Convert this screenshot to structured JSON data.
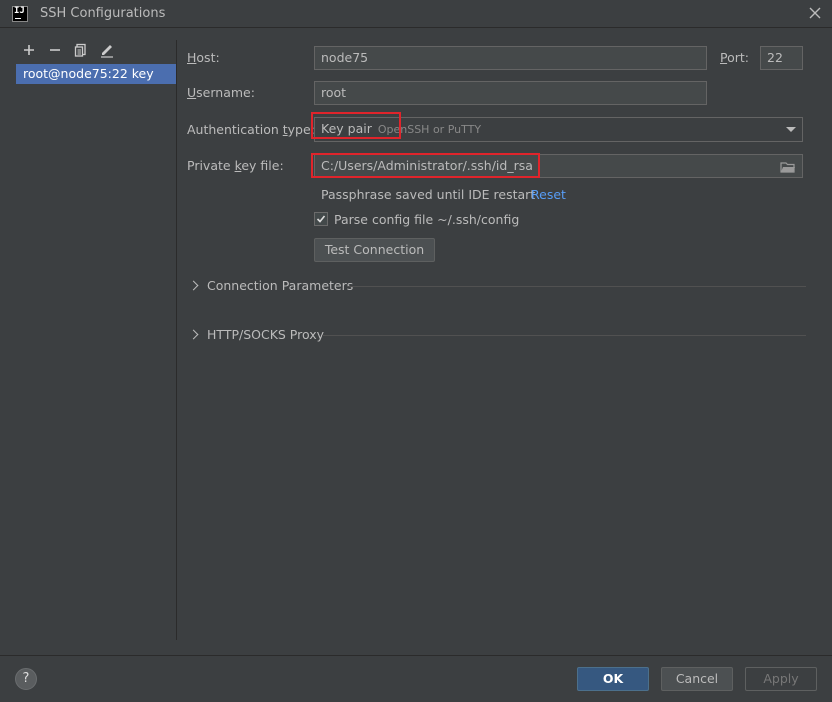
{
  "window": {
    "title": "SSH Configurations",
    "logo_text": "IJ"
  },
  "sidebar": {
    "toolbar_icons": [
      "plus-icon",
      "minus-icon",
      "copy-icon",
      "edit-icon"
    ],
    "items": [
      {
        "label": "root@node75:22 key",
        "selected": true
      }
    ]
  },
  "form": {
    "host": {
      "label_mnemonic": "H",
      "label_rest": "ost:",
      "value": "node75"
    },
    "port": {
      "label_mnemonic": "P",
      "label_rest": "ort:",
      "value": "22"
    },
    "username": {
      "label_mnemonic": "U",
      "label_rest": "sername:",
      "value": "root"
    },
    "auth": {
      "label_prefix": "Authentication ",
      "label_mnemonic": "t",
      "label_rest": "ype:",
      "value": "Key pair",
      "hint": "OpenSSH or PuTTY"
    },
    "private_key": {
      "label_prefix": "Private ",
      "label_mnemonic": "k",
      "label_rest": "ey file:",
      "value": "C:/Users/Administrator/.ssh/id_rsa"
    },
    "passphrase_text": "Passphrase saved until IDE restart",
    "reset_label": "Reset",
    "parse_config": {
      "label": "Parse config file ~/.ssh/config",
      "checked": true
    },
    "test_connection_label": "Test Connection"
  },
  "sections": [
    {
      "label": "Connection Parameters",
      "expanded": false
    },
    {
      "label": "HTTP/SOCKS Proxy",
      "expanded": false
    }
  ],
  "footer": {
    "help_label": "?",
    "ok_label": "OK",
    "cancel_label": "Cancel",
    "apply_label": "Apply",
    "apply_enabled": false
  },
  "colors": {
    "background": "#3c3f41",
    "selection": "#4b6eaf",
    "link": "#589df6",
    "highlight_box": "#e0242b",
    "default_button": "#365880"
  }
}
